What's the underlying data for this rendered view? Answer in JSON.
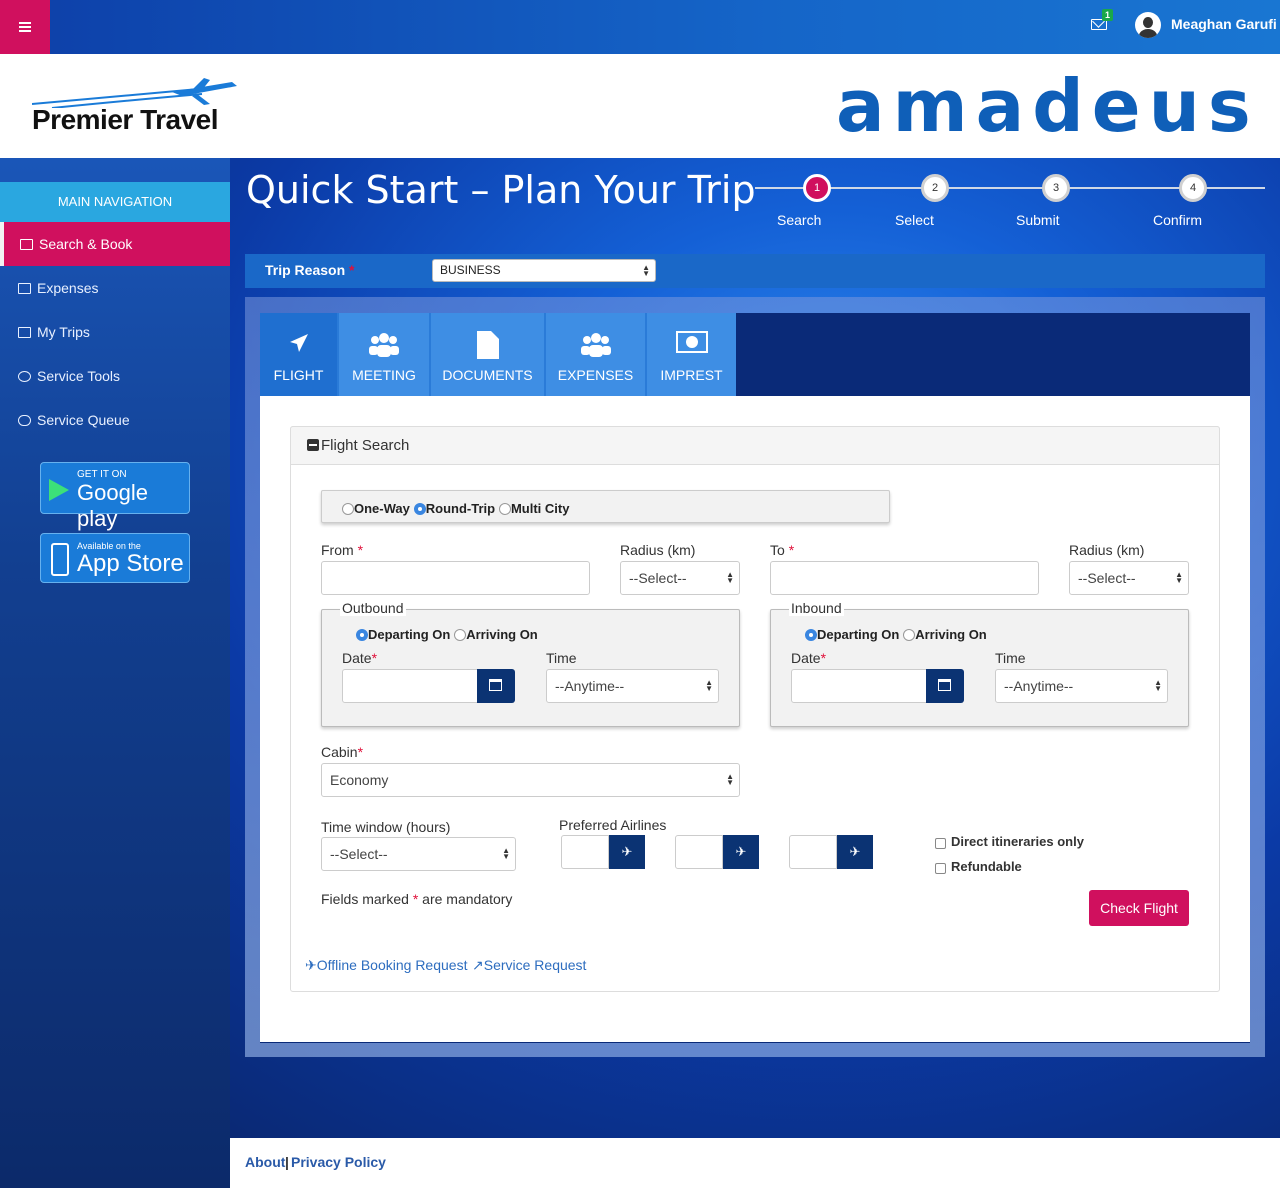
{
  "topbar": {
    "mail_count": "1",
    "user_name": "Meaghan Garufi"
  },
  "header": {
    "brand": "Premier Travel",
    "partner": "amadeus"
  },
  "sidebar": {
    "heading": "MAIN NAVIGATION",
    "items": [
      {
        "label": "Search & Book",
        "icon": "edit-icon"
      },
      {
        "label": "Expenses",
        "icon": "money-icon"
      },
      {
        "label": "My Trips",
        "icon": "list-icon"
      },
      {
        "label": "Service Tools",
        "icon": "gears-icon"
      },
      {
        "label": "Service Queue",
        "icon": "handshake-icon"
      }
    ],
    "google_small": "GET IT ON",
    "google_big": "Google play",
    "apple_small": "Available on the",
    "apple_big": "App Store"
  },
  "page": {
    "title": "Quick Start – Plan Your Trip"
  },
  "steps": [
    {
      "num": "1",
      "label": "Search"
    },
    {
      "num": "2",
      "label": "Select"
    },
    {
      "num": "3",
      "label": "Submit"
    },
    {
      "num": "4",
      "label": "Confirm"
    }
  ],
  "trip": {
    "label": "Trip Reason",
    "value": "BUSINESS"
  },
  "tabs": [
    "FLIGHT",
    "MEETING",
    "DOCUMENTS",
    "EXPENSES",
    "IMPREST"
  ],
  "flight": {
    "section_title": "Flight Search",
    "trip_types": [
      "One-Way",
      "Round-Trip",
      "Multi City"
    ],
    "from_label": "From",
    "to_label": "To",
    "radius_label": "Radius (km)",
    "radius_value": "--Select--",
    "outbound": "Outbound",
    "inbound": "Inbound",
    "departing": "Departing On",
    "arriving": "Arriving On",
    "date_label": "Date",
    "time_label": "Time",
    "time_value": "--Anytime--",
    "cabin_label": "Cabin",
    "cabin_value": "Economy",
    "window_label": "Time window (hours)",
    "window_value": "--Select--",
    "airlines_label": "Preferred Airlines",
    "direct_label": "Direct itineraries only",
    "refundable_label": "Refundable",
    "mandatory_pre": "Fields marked",
    "mandatory_post": "are mandatory",
    "check_button": "Check Flight",
    "offline_link": "Offline Booking Request",
    "service_link": "Service Request"
  },
  "footer": {
    "about": "About",
    "privacy": "Privacy Policy",
    "sep": "|"
  },
  "colors": {
    "accent": "#d0105e",
    "primary": "#1565c8",
    "dark": "#0b3373"
  }
}
